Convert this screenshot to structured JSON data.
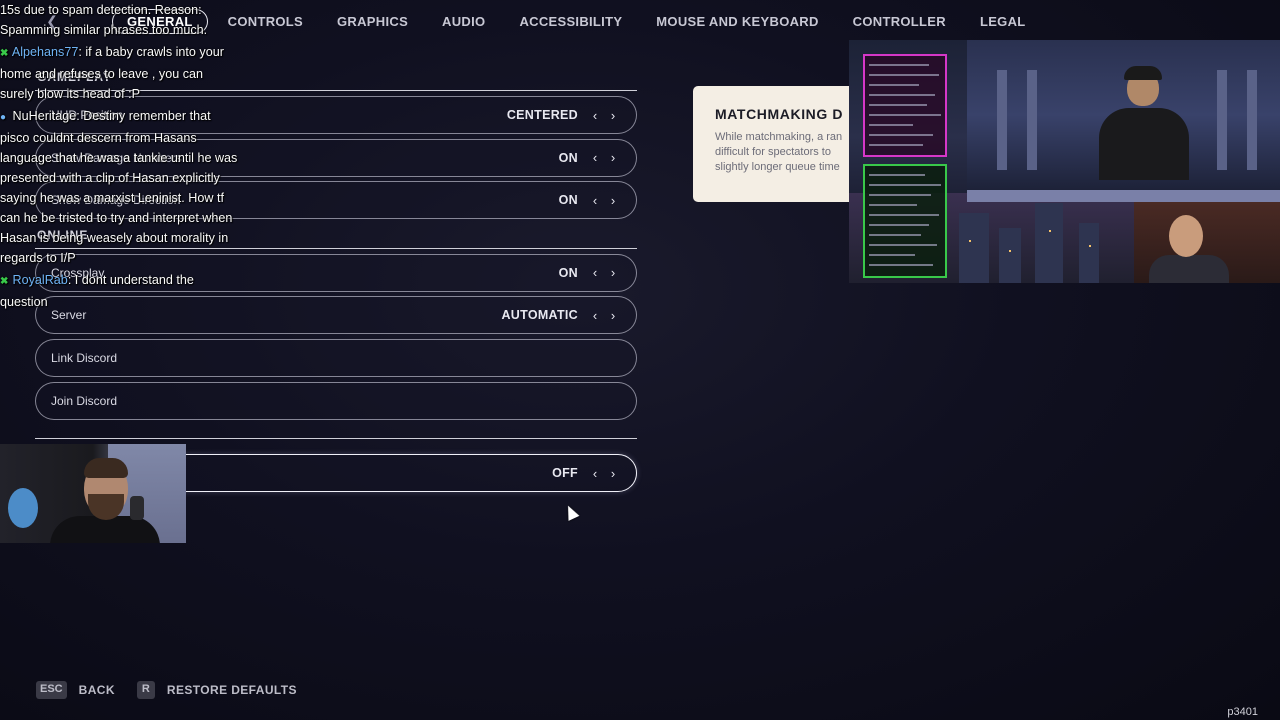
{
  "nav": {
    "back_icon": "chevron-left-icon",
    "tabs": [
      {
        "label": "GENERAL",
        "active": true
      },
      {
        "label": "CONTROLS"
      },
      {
        "label": "GRAPHICS"
      },
      {
        "label": "AUDIO"
      },
      {
        "label": "ACCESSIBILITY"
      },
      {
        "label": "MOUSE AND KEYBOARD"
      },
      {
        "label": "CONTROLLER"
      },
      {
        "label": "LEGAL"
      }
    ]
  },
  "sections": {
    "gameplay": {
      "title": "GAMEPLAY",
      "rows": [
        {
          "label": "HUD Position",
          "value": "CENTERED"
        },
        {
          "label": "Show Damage Numbers",
          "value": "ON"
        },
        {
          "label": "Show Damage Direction",
          "value": "ON"
        }
      ]
    },
    "online": {
      "title": "ONLINE",
      "rows": [
        {
          "label": "Crossplay",
          "value": "ON"
        },
        {
          "label": "Server",
          "value": "AUTOMATIC"
        }
      ],
      "buttons": [
        {
          "label": "Link Discord"
        },
        {
          "label": "Join Discord"
        }
      ]
    },
    "last_row": {
      "label": "",
      "value": "OFF"
    }
  },
  "info": {
    "title": "MATCHMAKING D",
    "lines": [
      "While matchmaking, a ran",
      "difficult for spectators to",
      "slightly longer queue time"
    ]
  },
  "chat": [
    {
      "user": "",
      "text": "15s due to spam detection. Reason: Spamming similar phrases too much.",
      "user_color": "#ffffff",
      "badge": ""
    },
    {
      "user": "Alpehans77",
      "text": ": if a baby crawls into your home and refuses to leave , you can surely blow its head of :P",
      "user_color": "#6fb3f5",
      "badge": "✖"
    },
    {
      "user": "NuHeritage",
      "text": ": Destiny remember that pisco couldnt descern from Hasans language that he was a tankie until he was presented with a clip of Hasan explicitly saying he was a marxist Leninist. How tf can he be tristed to try and interpret when Hasan is being weasely about morality in regards to I/P",
      "user_color": "#ffffff",
      "badge": "●"
    },
    {
      "user": "RoyalRab",
      "text": ": I dont understand the question",
      "user_color": "#6fb3f5",
      "badge": "✖"
    }
  ],
  "footer": {
    "back_key": "ESC",
    "back_label": "BACK",
    "restore_key": "R",
    "restore_label": "RESTORE DEFAULTS"
  },
  "watermark": "p3401",
  "colors": {
    "background": "#101020",
    "info_bg": "#f4eee4",
    "chat_user_blue": "#6fb3f5",
    "badge_green": "#39c94a",
    "stream_chat_pink": "#d637c8"
  }
}
